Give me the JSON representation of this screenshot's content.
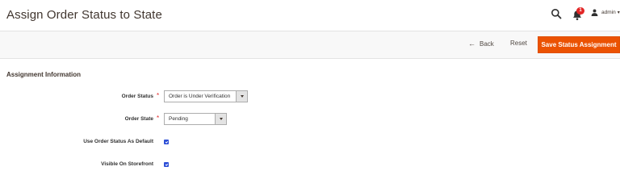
{
  "header": {
    "title": "Assign Order Status to State",
    "notifications_count": "1",
    "user_name": "admin",
    "user_caret": "▾"
  },
  "action_bar": {
    "back_label": "Back",
    "back_arrow": "←",
    "reset_label": "Reset",
    "save_label": "Save Status Assignment",
    "save_color": "#eb5202"
  },
  "form": {
    "section_title": "Assignment Information",
    "required_marker": "*",
    "order_status": {
      "label": "Order Status",
      "value": "Order is Under Verification"
    },
    "order_state": {
      "label": "Order State",
      "value": "Pending"
    },
    "use_default": {
      "label": "Use Order Status As Default",
      "checked": true
    },
    "visible_storefront": {
      "label": "Visible On Storefront",
      "checked": true
    }
  },
  "colors": {
    "required": "#e22626",
    "checkbox": "#2d4fd6",
    "badge": "#e22626"
  }
}
